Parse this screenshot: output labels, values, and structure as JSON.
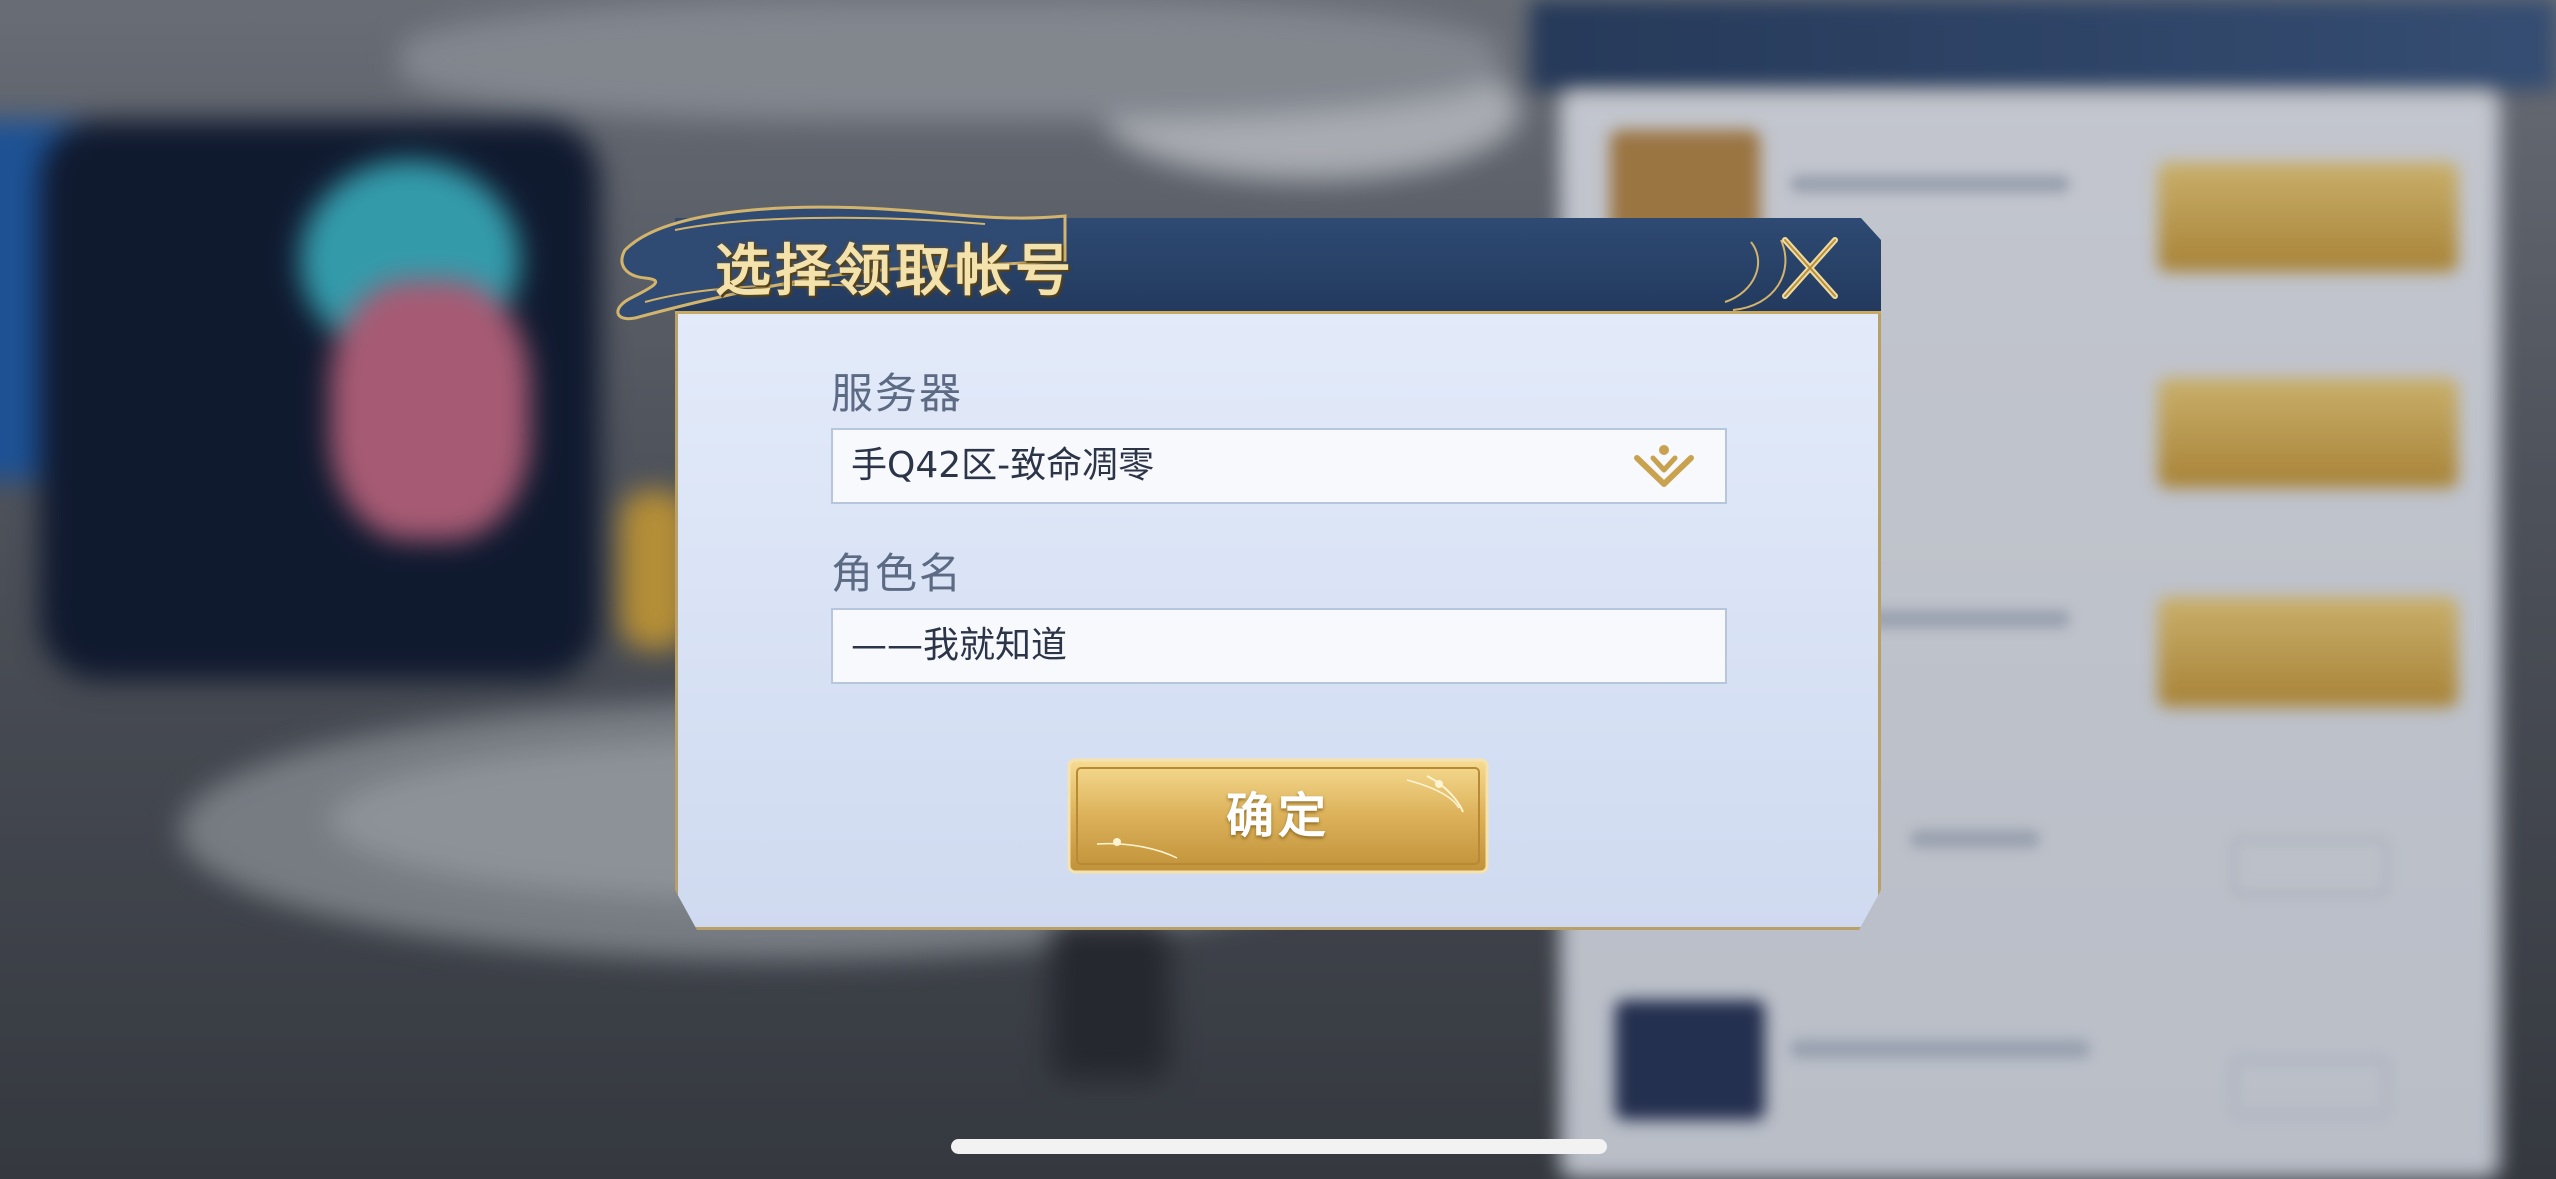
{
  "dialog": {
    "title": "选择领取帐号",
    "server_label": "服务器",
    "server_value": "手Q42区-致命凋零",
    "role_label": "角色名",
    "role_value": "——我就知道",
    "confirm_label": "确定"
  },
  "icons": {
    "close": "close-icon",
    "dropdown": "chevron-down-icon"
  },
  "colors": {
    "header_bg": "#233a5e",
    "title_gold": "#f4e2ad",
    "body_bg": "#dbe4f6",
    "button_gold": "#d9b35a"
  }
}
